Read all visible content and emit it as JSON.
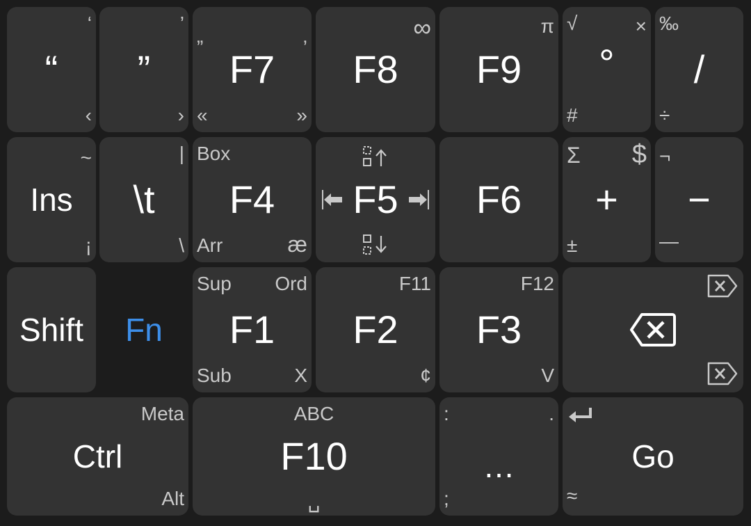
{
  "keyboard": {
    "layout": "Fn layer",
    "accent_color": "#3d8ee8",
    "key_color": "#333333",
    "background_color": "#1c1c1c",
    "rows": [
      [
        {
          "id": "left-quote",
          "main": "“",
          "tr": "‘",
          "br": "‹"
        },
        {
          "id": "right-quote",
          "main": "”",
          "tr": "’",
          "br": "›"
        },
        {
          "id": "f7",
          "main": "F7",
          "tl": "„",
          "tr": "‚",
          "bl": "«",
          "br": "»"
        },
        {
          "id": "f8",
          "main": "F8",
          "tr": "∞"
        },
        {
          "id": "f9",
          "main": "F9",
          "tr": "π"
        },
        {
          "id": "degree",
          "main": "°",
          "tl": "√",
          "tr": "×",
          "bl": "#"
        },
        {
          "id": "slash",
          "main": "/",
          "tl": "‰",
          "bl": "÷"
        }
      ],
      [
        {
          "id": "insert",
          "main": "Ins",
          "tr": "~",
          "br": "¡"
        },
        {
          "id": "tab",
          "main": "\\t",
          "tr": "|",
          "br": "\\"
        },
        {
          "id": "f4",
          "main": "F4",
          "tl": "Box",
          "bl": "Arr",
          "br": "æ"
        },
        {
          "id": "f5",
          "main": "F5",
          "tc": "select-up-icon",
          "bc": "select-down-icon",
          "ml": "home-icon",
          "mr": "end-icon"
        },
        {
          "id": "f6",
          "main": "F6"
        },
        {
          "id": "plus",
          "main": "+",
          "tl": "Σ",
          "tr": "$",
          "bl": "±"
        },
        {
          "id": "minus",
          "main": "−",
          "tl": "¬",
          "bl": "—"
        }
      ],
      [
        {
          "id": "shift",
          "main": "Shift"
        },
        {
          "id": "fn",
          "main": "Fn",
          "active": true
        },
        {
          "id": "f1",
          "main": "F1",
          "tl": "Sup",
          "tr": "Ord",
          "bl": "Sub",
          "br": "X"
        },
        {
          "id": "f2",
          "main": "F2",
          "tr": "F11",
          "br": "¢"
        },
        {
          "id": "f3",
          "main": "F3",
          "tr": "F12",
          "br": "V"
        },
        {
          "id": "backspace",
          "main_icon": "backspace-icon",
          "tr": "delete-icon",
          "br": "delete-word-icon"
        }
      ],
      [
        {
          "id": "ctrl",
          "main": "Ctrl",
          "tr": "Meta",
          "br": "Alt"
        },
        {
          "id": "f10",
          "main": "F10",
          "tc": "ABC",
          "bc": "␣"
        },
        {
          "id": "ellipsis",
          "main": "…",
          "tl": ":",
          "tr": ".",
          "bl": ";"
        },
        {
          "id": "go",
          "main": "Go",
          "tl": "enter-icon",
          "bl": "≈"
        }
      ]
    ]
  }
}
